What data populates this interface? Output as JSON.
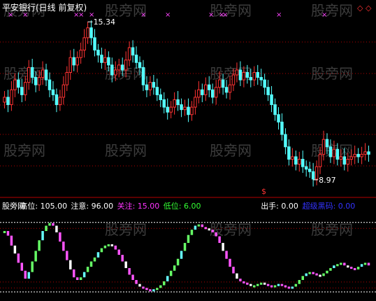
{
  "header": {
    "title": "平安银行(日线 前复权)",
    "watermark": "股旁网",
    "corner_marks": "◇ ◇"
  },
  "price_panel": {
    "high_label": "15.34",
    "low_label": "8.97",
    "signal_glyph": "$"
  },
  "indicator_panel": {
    "labels": [
      {
        "key": "name",
        "text": "股旁网",
        "color": "#ffffff"
      },
      {
        "key": "high",
        "text": "高位: 105.00",
        "color": "#ffffff"
      },
      {
        "key": "note",
        "text": "注意: 96.00",
        "color": "#ffffff"
      },
      {
        "key": "focus",
        "text": "关注: 15.00",
        "color": "#ff33ff"
      },
      {
        "key": "low",
        "text": "低位: 6.00",
        "color": "#33ff33"
      },
      {
        "key": "sell",
        "text": "出手: 0.00",
        "color": "#ffffff"
      },
      {
        "key": "super",
        "text": "超级黑码: 0.00",
        "color": "#3333ff"
      }
    ]
  },
  "colors": {
    "background": "#000000",
    "up": "#ff3333",
    "down": "#54ffff",
    "grid": "#b40000",
    "label": "#ffffff",
    "cross": "#ff44ff",
    "watermark": "#3c3c3c",
    "osc_green": "#66ff66",
    "osc_magenta": "#ff55ff",
    "osc_cyan": "#66ffff",
    "osc_white": "#ffffff"
  },
  "chart_data": [
    {
      "type": "candlestick",
      "title": "平安银行(日线 前复权)",
      "ylim": [
        8.6,
        15.6
      ],
      "annotations": [
        {
          "text": "15.34",
          "value": 15.34
        },
        {
          "text": "8.97",
          "value": 8.97
        }
      ],
      "close": [
        12.3,
        12.0,
        12.6,
        13.0,
        12.7,
        12.4,
        12.9,
        13.5,
        13.1,
        12.8,
        13.1,
        13.4,
        13.0,
        12.6,
        12.4,
        12.0,
        12.3,
        12.8,
        13.3,
        13.9,
        13.6,
        13.9,
        14.2,
        14.7,
        15.1,
        14.7,
        14.2,
        14.0,
        13.7,
        13.9,
        13.6,
        13.2,
        13.4,
        13.6,
        13.4,
        13.8,
        14.3,
        14.0,
        13.7,
        13.5,
        12.8,
        12.6,
        12.9,
        12.7,
        12.4,
        12.2,
        11.9,
        11.7,
        11.9,
        12.2,
        12.0,
        11.8,
        11.9,
        11.6,
        11.9,
        12.3,
        12.6,
        12.4,
        12.8,
        12.6,
        12.3,
        12.7,
        13.0,
        12.7,
        12.5,
        12.8,
        13.2,
        13.4,
        13.0,
        13.3,
        13.1,
        13.0,
        13.3,
        13.1,
        13.0,
        12.7,
        12.4,
        12.0,
        11.6,
        11.3,
        10.8,
        10.3,
        9.8,
        9.9,
        9.6,
        9.8,
        9.5,
        9.4,
        9.3,
        9.0,
        9.5,
        10.0,
        10.6,
        10.3,
        9.9,
        10.2,
        9.8,
        9.9,
        9.6,
        9.8,
        9.9,
        10.0,
        9.9,
        10.0,
        10.1,
        10.0
      ],
      "xlabel": "",
      "ylabel": ""
    },
    {
      "type": "line",
      "title": "",
      "ylim": [
        0,
        110
      ],
      "reference_lines": [
        105,
        96,
        15,
        6,
        0
      ],
      "values": [
        92,
        85,
        70,
        58,
        44,
        32,
        20,
        30,
        46,
        62,
        78,
        92,
        100,
        104,
        100,
        90,
        76,
        62,
        48,
        34,
        22,
        18,
        22,
        30,
        38,
        46,
        52,
        60,
        66,
        70,
        72,
        70,
        64,
        56,
        46,
        36,
        26,
        18,
        12,
        8,
        6,
        4,
        3,
        4,
        6,
        10,
        16,
        24,
        32,
        40,
        50,
        62,
        74,
        86,
        94,
        100,
        102,
        98,
        96,
        94,
        90,
        84,
        74,
        62,
        50,
        38,
        28,
        20,
        16,
        14,
        12,
        10,
        10,
        12,
        14,
        12,
        10,
        8,
        10,
        12,
        10,
        8,
        6,
        8,
        12,
        18,
        24,
        28,
        30,
        28,
        26,
        24,
        28,
        32,
        36,
        40,
        42,
        44,
        40,
        38,
        36,
        34,
        38,
        42,
        44,
        40
      ],
      "xlabel": "",
      "ylabel": ""
    }
  ]
}
